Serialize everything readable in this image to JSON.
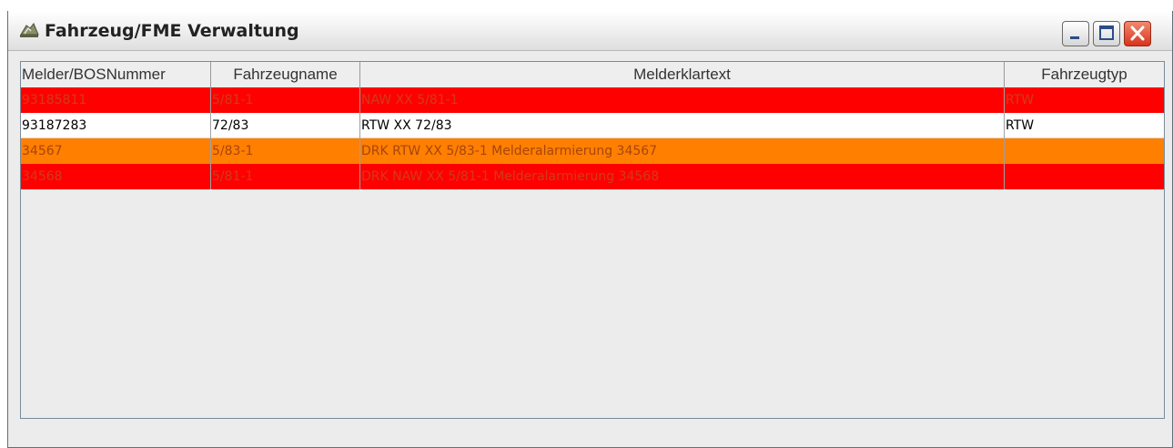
{
  "window": {
    "title": "Fahrzeug/FME Verwaltung"
  },
  "icons": {
    "app": "fire-helmet-icon",
    "minimize": "minimize-icon",
    "maximize": "maximize-icon",
    "close": "close-icon",
    "scroll_left": "arrow-left-icon",
    "scroll_right": "arrow-right-icon"
  },
  "table": {
    "columns": [
      "Melder/BOSNummer",
      "Fahrzeugname",
      "Melderklartext",
      "Fahrzeugtyp"
    ],
    "rows": [
      {
        "color": "#ff0000",
        "cells": [
          "93185811",
          "5/81-1",
          "NAW XX 5/81-1",
          "RTW"
        ]
      },
      {
        "color": "#ffffff",
        "cells": [
          "93187283",
          "72/83",
          "RTW XX 72/83",
          "RTW"
        ]
      },
      {
        "color": "#ff7f00",
        "cells": [
          "34567",
          "5/83-1",
          "DRK RTW XX 5/83-1 Melderalarmierung 34567",
          ""
        ]
      },
      {
        "color": "#ff0000",
        "cells": [
          "34568",
          "5/81-1",
          "DRK NAW XX 5/81-1 Melderalarmierung 34568",
          ""
        ]
      }
    ]
  }
}
